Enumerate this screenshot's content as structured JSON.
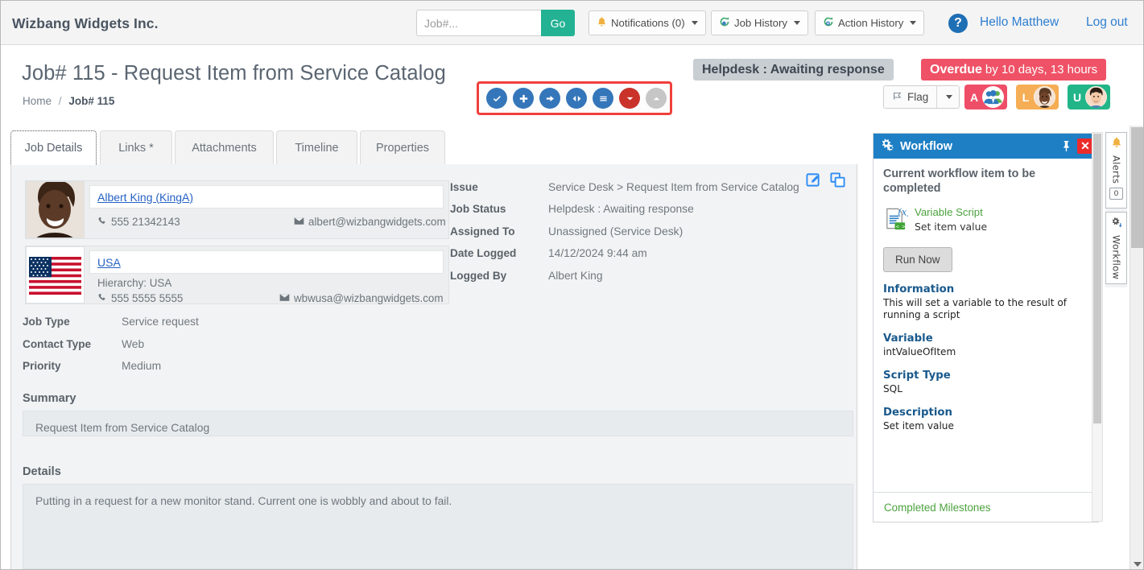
{
  "header": {
    "brand": "Wizbang Widgets Inc.",
    "search": {
      "placeholder": "Job#...",
      "value": "",
      "go_label": "Go"
    },
    "buttons": [
      {
        "name": "notifications",
        "label": "Notifications (0)",
        "icon": "bell-icon"
      },
      {
        "name": "job-history",
        "label": "Job History",
        "icon": "history-icon"
      },
      {
        "name": "action-history",
        "label": "Action History",
        "icon": "history-add-icon"
      }
    ],
    "help_icon": "question-mark-icon",
    "greeting": "Hello Matthew",
    "logout": "Log out"
  },
  "page": {
    "title": "Job# 115 - Request Item from Service Catalog",
    "breadcrumb": {
      "home": "Home",
      "separator": "/",
      "current": "Job# 115"
    },
    "status_badge": "Helpdesk : Awaiting response",
    "overdue": {
      "bold": "Overdue",
      "rest": "by 10 days, 13 hours"
    }
  },
  "action_toolbar": {
    "highlight_color": "#f0403c",
    "items": [
      {
        "name": "complete-action-button",
        "icon": "check-circle-icon",
        "color": "#3576ba"
      },
      {
        "name": "add-action-button",
        "icon": "plus-circle-icon",
        "color": "#3576ba"
      },
      {
        "name": "forward-action-button",
        "icon": "arrow-right-circle-icon",
        "color": "#3576ba"
      },
      {
        "name": "transfer-action-button",
        "icon": "arrows-left-right-circle-icon",
        "color": "#3576ba"
      },
      {
        "name": "list-action-button",
        "icon": "lines-circle-icon",
        "color": "#3576ba"
      },
      {
        "name": "more-actions-button",
        "icon": "chevron-down-circle-icon",
        "color": "#c9332a"
      },
      {
        "name": "collapse-button",
        "icon": "chevron-up-circle-icon",
        "color": "#c6c6c6"
      }
    ]
  },
  "flag": {
    "label": "Flag",
    "icon": "flag-icon"
  },
  "chips": [
    {
      "letter": "A",
      "color": "#ef4e68",
      "avatar": "group-people-icon"
    },
    {
      "letter": "L",
      "color": "#f5ae55",
      "avatar": "photo-avatar"
    },
    {
      "letter": "U",
      "color": "#22b588",
      "avatar": "photo-avatar"
    }
  ],
  "tabs": [
    {
      "label": "Job Details",
      "active": true
    },
    {
      "label": "Links *",
      "active": false
    },
    {
      "label": "Attachments",
      "active": false
    },
    {
      "label": "Timeline",
      "active": false
    },
    {
      "label": "Properties",
      "active": false
    }
  ],
  "panel_icons": [
    {
      "name": "edit-icon",
      "color": "#2d8df5"
    },
    {
      "name": "copy-icon",
      "color": "#2d8df5"
    }
  ],
  "contact": {
    "name": "Albert King (KingA)",
    "phone": "555 21342143",
    "email": "albert@wizbangwidgets.com",
    "phone_icon": "phone-icon",
    "email_icon": "envelope-icon"
  },
  "organisation": {
    "name": "USA",
    "hierarchy": "Hierarchy: USA",
    "phone": "555 5555 5555",
    "email": "wbwusa@wizbangwidgets.com",
    "flag_icon": "usa-flag-icon"
  },
  "job_fields_right": [
    {
      "label": "Issue",
      "value": "Service Desk > Request Item from Service Catalog"
    },
    {
      "label": "Job Status",
      "value": "Helpdesk : Awaiting response"
    },
    {
      "label": "Assigned To",
      "value": "Unassigned (Service Desk)"
    },
    {
      "label": "Date Logged",
      "value": "14/12/2024 9:44 am"
    },
    {
      "label": "Logged By",
      "value": "Albert King"
    }
  ],
  "job_fields_left": [
    {
      "label": "Job Type",
      "value": "Service request"
    },
    {
      "label": "Contact Type",
      "value": "Web"
    },
    {
      "label": "Priority",
      "value": "Medium"
    }
  ],
  "summary": {
    "heading": "Summary",
    "text": "Request Item from Service Catalog"
  },
  "details": {
    "heading": "Details",
    "text": "Putting in a request for a new monitor stand.  Current one is wobbly and about to fail."
  },
  "workflow": {
    "title": "Workflow",
    "title_icon": "gears-icon",
    "pin_icon": "pin-icon",
    "close_icon": "close-x-icon",
    "heading": "Current workflow item to be completed",
    "item": {
      "name": "Variable Script",
      "sub": "Set item value",
      "icon": "variable-script-icon"
    },
    "run_button": "Run Now",
    "sections": [
      {
        "heading": "Information",
        "text": "This will set a variable to the result of running a script"
      },
      {
        "heading": "Variable",
        "text": "intValueOfItem"
      },
      {
        "heading": "Script Type",
        "text": "SQL"
      },
      {
        "heading": "Description",
        "text": "Set item value"
      }
    ],
    "footer_link": "Completed Milestones"
  },
  "rail": [
    {
      "label": "Alerts",
      "icon": "bell-icon",
      "count": "0"
    },
    {
      "label": "Workflow",
      "icon": "gears-icon",
      "count": null
    }
  ]
}
